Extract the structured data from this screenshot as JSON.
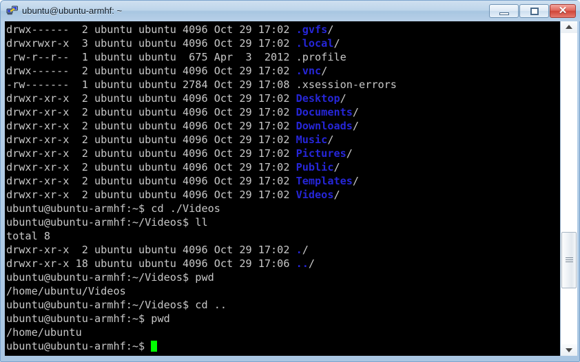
{
  "window": {
    "title": "ubuntu@ubuntu-armhf: ~",
    "icon": "terminal-network-icon",
    "controls": {
      "minimize_label": "–",
      "maximize_label": "□",
      "close_label": "✕"
    },
    "colors": {
      "titlebar_top": "#cfe0f0",
      "titlebar_bottom": "#b8d0e8",
      "frame": "#a9c6e2",
      "close_button": "#cf4538",
      "terminal_background": "#000000",
      "terminal_foreground": "#c8c8c8",
      "directory_color": "#2626d8",
      "cursor_color": "#00ff00"
    }
  },
  "terminal": {
    "lines": [
      {
        "id": "ls-gvfs",
        "segments": [
          {
            "text": "drwx------  2 ubuntu ubuntu 4096 Oct 29 17:02 ",
            "type": "plain"
          },
          {
            "text": ".gvfs",
            "type": "dir"
          },
          {
            "text": "/",
            "type": "plain"
          }
        ]
      },
      {
        "id": "ls-local",
        "segments": [
          {
            "text": "drwxrwxr-x  3 ubuntu ubuntu 4096 Oct 29 17:02 ",
            "type": "plain"
          },
          {
            "text": ".local",
            "type": "dir"
          },
          {
            "text": "/",
            "type": "plain"
          }
        ]
      },
      {
        "id": "ls-profile",
        "segments": [
          {
            "text": "-rw-r--r--  1 ubuntu ubuntu  675 Apr  3  2012 .profile",
            "type": "plain"
          }
        ]
      },
      {
        "id": "ls-vnc",
        "segments": [
          {
            "text": "drwx------  2 ubuntu ubuntu 4096 Oct 29 17:02 ",
            "type": "plain"
          },
          {
            "text": ".vnc",
            "type": "dir"
          },
          {
            "text": "/",
            "type": "plain"
          }
        ]
      },
      {
        "id": "ls-xsession-errors",
        "segments": [
          {
            "text": "-rw-------  1 ubuntu ubuntu 2784 Oct 29 17:08 .xsession-errors",
            "type": "plain"
          }
        ]
      },
      {
        "id": "ls-desktop",
        "segments": [
          {
            "text": "drwxr-xr-x  2 ubuntu ubuntu 4096 Oct 29 17:02 ",
            "type": "plain"
          },
          {
            "text": "Desktop",
            "type": "dir"
          },
          {
            "text": "/",
            "type": "plain"
          }
        ]
      },
      {
        "id": "ls-documents",
        "segments": [
          {
            "text": "drwxr-xr-x  2 ubuntu ubuntu 4096 Oct 29 17:02 ",
            "type": "plain"
          },
          {
            "text": "Documents",
            "type": "dir"
          },
          {
            "text": "/",
            "type": "plain"
          }
        ]
      },
      {
        "id": "ls-downloads",
        "segments": [
          {
            "text": "drwxr-xr-x  2 ubuntu ubuntu 4096 Oct 29 17:02 ",
            "type": "plain"
          },
          {
            "text": "Downloads",
            "type": "dir"
          },
          {
            "text": "/",
            "type": "plain"
          }
        ]
      },
      {
        "id": "ls-music",
        "segments": [
          {
            "text": "drwxr-xr-x  2 ubuntu ubuntu 4096 Oct 29 17:02 ",
            "type": "plain"
          },
          {
            "text": "Music",
            "type": "dir"
          },
          {
            "text": "/",
            "type": "plain"
          }
        ]
      },
      {
        "id": "ls-pictures",
        "segments": [
          {
            "text": "drwxr-xr-x  2 ubuntu ubuntu 4096 Oct 29 17:02 ",
            "type": "plain"
          },
          {
            "text": "Pictures",
            "type": "dir"
          },
          {
            "text": "/",
            "type": "plain"
          }
        ]
      },
      {
        "id": "ls-public",
        "segments": [
          {
            "text": "drwxr-xr-x  2 ubuntu ubuntu 4096 Oct 29 17:02 ",
            "type": "plain"
          },
          {
            "text": "Public",
            "type": "dir"
          },
          {
            "text": "/",
            "type": "plain"
          }
        ]
      },
      {
        "id": "ls-templates",
        "segments": [
          {
            "text": "drwxr-xr-x  2 ubuntu ubuntu 4096 Oct 29 17:02 ",
            "type": "plain"
          },
          {
            "text": "Templates",
            "type": "dir"
          },
          {
            "text": "/",
            "type": "plain"
          }
        ]
      },
      {
        "id": "ls-videos",
        "segments": [
          {
            "text": "drwxr-xr-x  2 ubuntu ubuntu 4096 Oct 29 17:02 ",
            "type": "plain"
          },
          {
            "text": "Videos",
            "type": "dir"
          },
          {
            "text": "/",
            "type": "plain"
          }
        ]
      },
      {
        "id": "cmd-cd-videos",
        "segments": [
          {
            "text": "ubuntu@ubuntu-armhf:~$ cd ./Videos",
            "type": "plain"
          }
        ]
      },
      {
        "id": "cmd-ll",
        "segments": [
          {
            "text": "ubuntu@ubuntu-armhf:~/Videos$ ll",
            "type": "plain"
          }
        ]
      },
      {
        "id": "out-total",
        "segments": [
          {
            "text": "total 8",
            "type": "plain"
          }
        ]
      },
      {
        "id": "ls-dot",
        "segments": [
          {
            "text": "drwxr-xr-x  2 ubuntu ubuntu 4096 Oct 29 17:02 ",
            "type": "plain"
          },
          {
            "text": ".",
            "type": "dir"
          },
          {
            "text": "/",
            "type": "plain"
          }
        ]
      },
      {
        "id": "ls-dotdot",
        "segments": [
          {
            "text": "drwxr-xr-x 18 ubuntu ubuntu 4096 Oct 29 17:06 ",
            "type": "plain"
          },
          {
            "text": "..",
            "type": "dir"
          },
          {
            "text": "/",
            "type": "plain"
          }
        ]
      },
      {
        "id": "cmd-pwd-videos",
        "segments": [
          {
            "text": "ubuntu@ubuntu-armhf:~/Videos$ pwd",
            "type": "plain"
          }
        ]
      },
      {
        "id": "out-pwd-videos",
        "segments": [
          {
            "text": "/home/ubuntu/Videos",
            "type": "plain"
          }
        ]
      },
      {
        "id": "cmd-cd-up",
        "segments": [
          {
            "text": "ubuntu@ubuntu-armhf:~/Videos$ cd ..",
            "type": "plain"
          }
        ]
      },
      {
        "id": "cmd-pwd-home",
        "segments": [
          {
            "text": "ubuntu@ubuntu-armhf:~$ pwd",
            "type": "plain"
          }
        ]
      },
      {
        "id": "out-pwd-home",
        "segments": [
          {
            "text": "/home/ubuntu",
            "type": "plain"
          }
        ]
      },
      {
        "id": "prompt-active",
        "segments": [
          {
            "text": "ubuntu@ubuntu-armhf:~$ ",
            "type": "plain"
          },
          {
            "text": "",
            "type": "cursor"
          }
        ]
      }
    ]
  },
  "scrollbar": {
    "up_arrow": "scroll-up-arrow",
    "down_arrow": "scroll-down-arrow",
    "thumb_position_percent": 78
  }
}
